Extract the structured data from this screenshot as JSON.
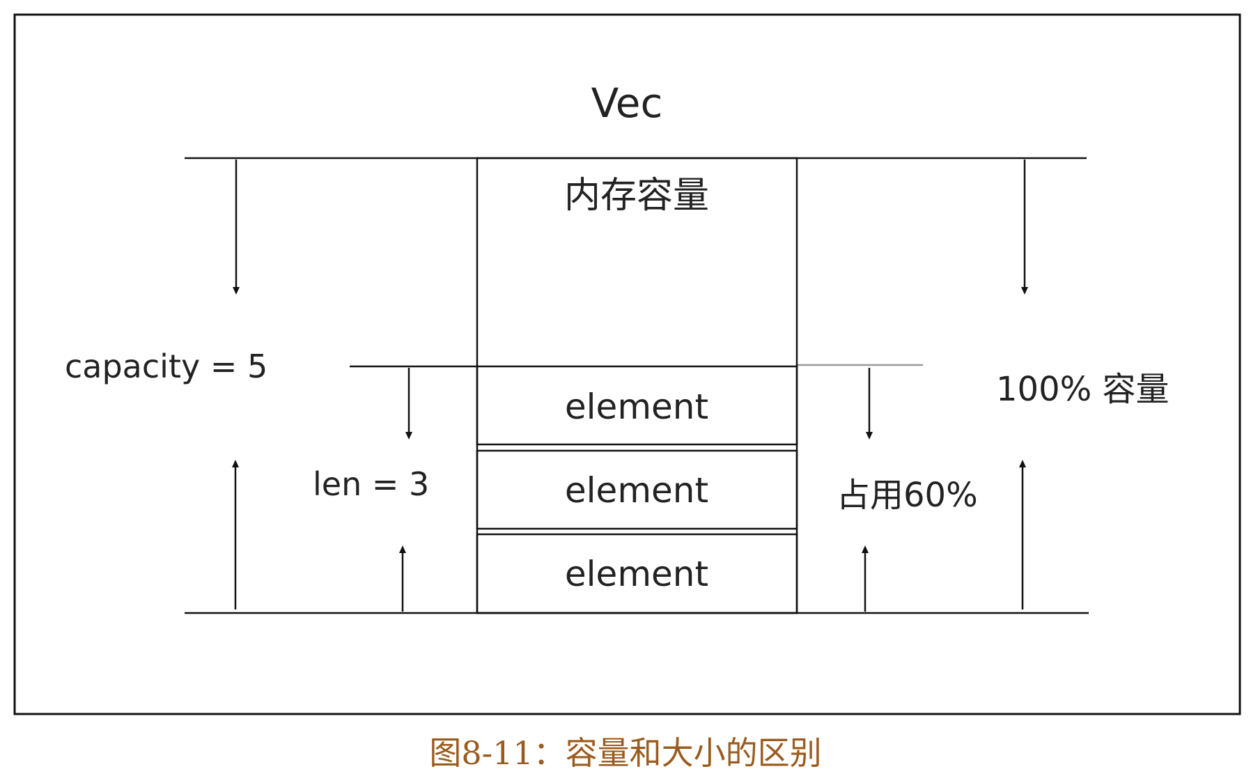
{
  "diagram": {
    "title": "Vec",
    "memory_label": "内存容量",
    "element_label": "element",
    "capacity_label": "capacity = 5",
    "len_label": "len = 3",
    "full_label": "100% 容量",
    "used_label": "占用60%"
  },
  "caption": {
    "text": "图8-11：容量和大小的区别",
    "color": "#9a5b1e"
  }
}
